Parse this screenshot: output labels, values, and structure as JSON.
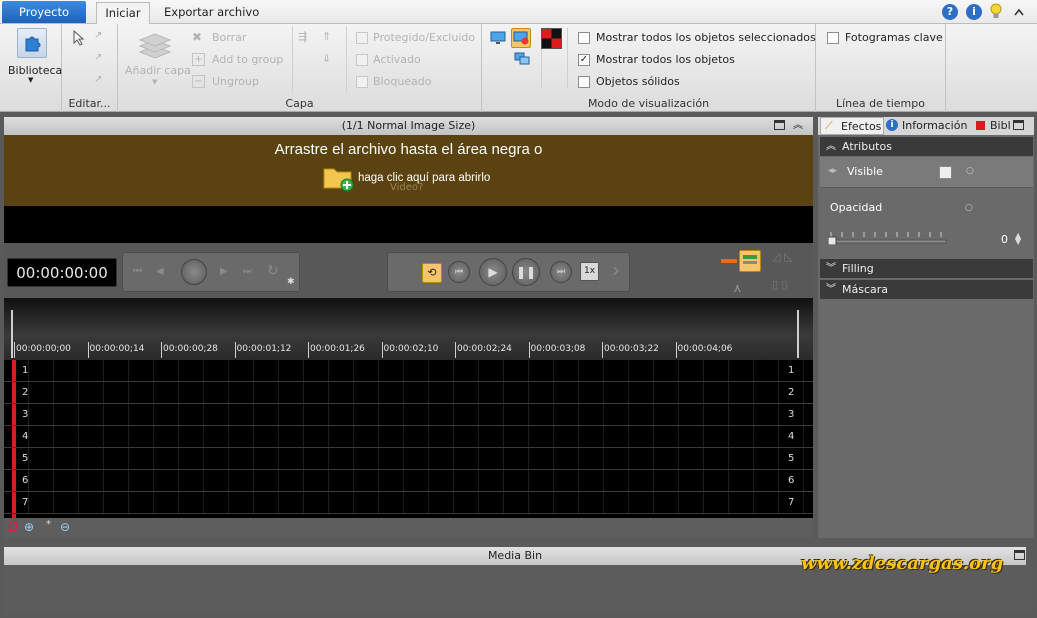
{
  "tabs": {
    "proyecto": "Proyecto",
    "iniciar": "Iniciar",
    "exportar": "Exportar archivo"
  },
  "ribbon": {
    "biblioteca": "Biblioteca",
    "editar": "Editar...",
    "anadir_capa": "Añadir capa",
    "borrar": "Borrar",
    "add_to_group": "Add to group",
    "ungroup": "Ungroup",
    "capa": "Capa",
    "protegido": "Protegido/Excluido",
    "activado": "Activado",
    "bloqueado": "Bloqueado",
    "mostrar_sel": "Mostrar todos los objetos seleccionados",
    "mostrar_todos": "Mostrar todos los objetos",
    "objetos_solidos": "Objetos sólidos",
    "modo": "Modo de visualización",
    "fotogramas": "Fotogramas clave",
    "linea_tiempo": "Línea de tiempo"
  },
  "viewer": {
    "header": "(1/1  Normal Image Size)",
    "drag_text": "Arrastre el archivo hasta el área negra o",
    "click_text": "haga clic aquí para abrirlo",
    "video_hint": "Video?"
  },
  "transport": {
    "timecode": "00:00:00:00",
    "speed": "1x"
  },
  "ruler": {
    "ticks": [
      "00:00:00;00",
      "00:00:00;14",
      "00:00:00;28",
      "00:00:01;12",
      "00:00:01;26",
      "00:00:02;10",
      "00:00:02;24",
      "00:00:03;08",
      "00:00:03;22",
      "00:00:04;06"
    ]
  },
  "tracks": {
    "numbers": [
      "1",
      "2",
      "3",
      "4",
      "5",
      "6",
      "7"
    ]
  },
  "panel": {
    "tab_efectos": "Efectos",
    "tab_info": "Información",
    "tab_bibl": "Bibl",
    "atributos": "Atributos",
    "visible": "Visible",
    "opacidad": "Opacidad",
    "opacity_value": "0",
    "filling": "Filling",
    "mascara": "Máscara"
  },
  "mediabin": {
    "title": "Media Bin"
  },
  "watermark": "www.zdescargas.org",
  "checkboxes": {
    "mostrar_todos_checked": true
  }
}
